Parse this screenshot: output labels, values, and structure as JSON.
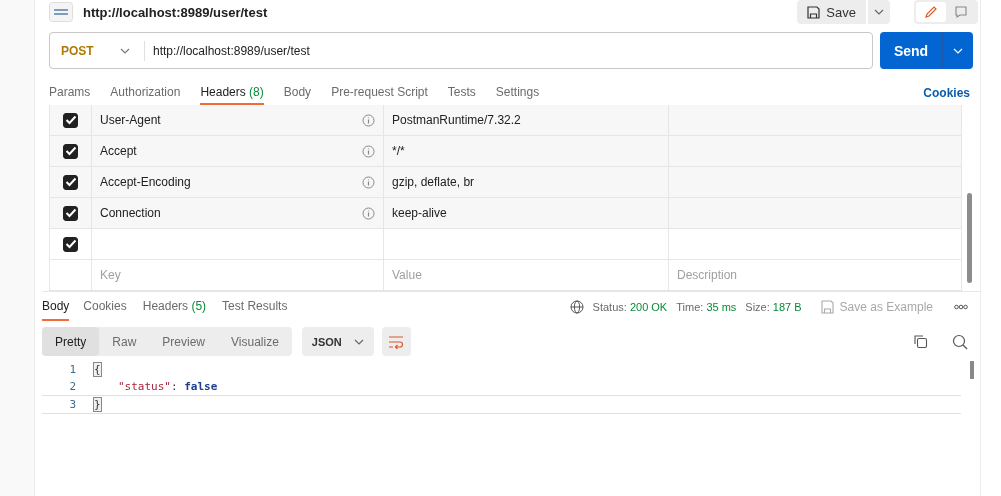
{
  "request": {
    "title": "http://localhost:8989/user/test",
    "save": "Save",
    "method": "POST",
    "url": "http://localhost:8989/user/test",
    "send": "Send"
  },
  "request_tabs": [
    {
      "label": "Params",
      "selected": false
    },
    {
      "label": "Authorization",
      "selected": false
    },
    {
      "label": "Headers",
      "count": "(8)",
      "selected": true
    },
    {
      "label": "Body",
      "selected": false
    },
    {
      "label": "Pre-request Script",
      "selected": false
    },
    {
      "label": "Tests",
      "selected": false
    },
    {
      "label": "Settings",
      "selected": false
    }
  ],
  "cookies_link": "Cookies",
  "headers": [
    {
      "checked": true,
      "auto": true,
      "key": "User-Agent",
      "value": "PostmanRuntime/7.32.2"
    },
    {
      "checked": true,
      "auto": true,
      "key": "Accept",
      "value": "*/*"
    },
    {
      "checked": true,
      "auto": true,
      "key": "Accept-Encoding",
      "value": "gzip, deflate, br"
    },
    {
      "checked": true,
      "auto": true,
      "key": "Connection",
      "value": "keep-alive"
    },
    {
      "checked": true,
      "auto": false
    }
  ],
  "header_placeholders": {
    "key": "Key",
    "value": "Value",
    "description": "Description"
  },
  "response": {
    "tabs": [
      {
        "label": "Body",
        "selected": true
      },
      {
        "label": "Cookies",
        "selected": false
      },
      {
        "label": "Headers",
        "count": "(5)",
        "selected": false
      },
      {
        "label": "Test Results",
        "selected": false
      }
    ],
    "stats": [
      {
        "label": "Status:",
        "value": "200 OK"
      },
      {
        "label": "Time:",
        "value": "35 ms"
      },
      {
        "label": "Size:",
        "value": "187 B"
      }
    ],
    "save_example": "Save as Example",
    "view_modes": [
      {
        "label": "Pretty",
        "selected": true
      },
      {
        "label": "Raw",
        "selected": false
      },
      {
        "label": "Preview",
        "selected": false
      },
      {
        "label": "Visualize",
        "selected": false
      }
    ],
    "format": "JSON",
    "lines": [
      {
        "number": "1",
        "current": false,
        "tokens": [
          {
            "kind": "brace",
            "text": "{"
          }
        ]
      },
      {
        "number": "2",
        "current": false,
        "tokens": [
          {
            "kind": "key",
            "text": "\"status\""
          },
          {
            "kind": "punct",
            "text": ": "
          },
          {
            "kind": "bool",
            "text": "false"
          }
        ]
      },
      {
        "number": "3",
        "current": true,
        "tokens": [
          {
            "kind": "brace",
            "text": "}"
          }
        ]
      }
    ]
  }
}
